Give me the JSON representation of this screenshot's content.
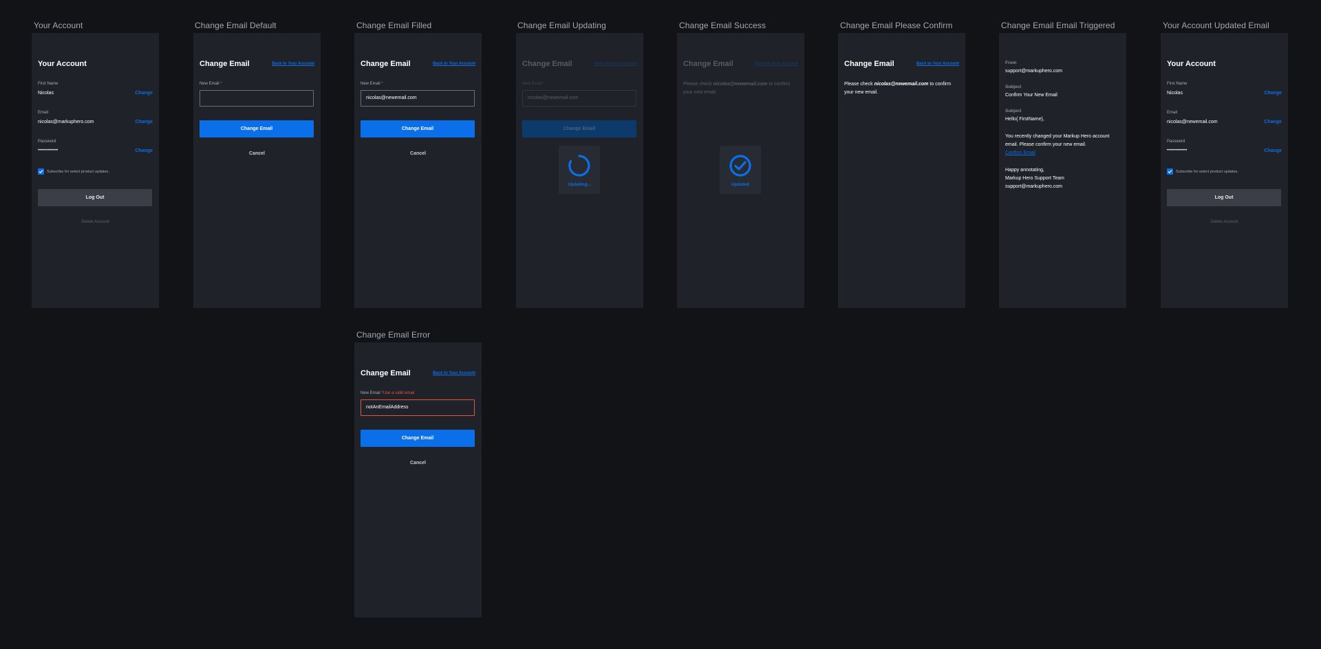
{
  "frames": {
    "account": {
      "label": "Your Account",
      "title": "Your Account",
      "first_name_label": "First Name",
      "first_name_value": "Nicolas",
      "email_label": "Email",
      "email_value": "nicolas@markuphero.com",
      "password_label": "Password",
      "password_value": "••••••••••••••",
      "change_label": "Change",
      "subscribe_label": "Subscribe for select product updates.",
      "subscribe_checked": true,
      "logout_label": "Log Out",
      "delete_label": "Delete Account"
    },
    "change_default": {
      "label": "Change Email Default",
      "title": "Change Email",
      "back_link": "Back to Your Account",
      "new_email_label": "New Email",
      "required_mark": "*",
      "input_value": "",
      "submit_label": "Change Email",
      "cancel_label": "Cancel"
    },
    "change_filled": {
      "label": "Change Email Filled",
      "title": "Change Email",
      "back_link": "Back to Your Account",
      "new_email_label": "New Email",
      "required_mark": "*",
      "input_value": "nicolas@newemail.com",
      "submit_label": "Change Email",
      "cancel_label": "Cancel"
    },
    "change_updating": {
      "label": "Change Email Updating",
      "title": "Change Email",
      "back_link": "Back to Your Account",
      "new_email_label": "New Email",
      "required_mark": "*",
      "input_value": "nicolas@newemail.com",
      "submit_label": "Change Email",
      "status_label": "Updating..."
    },
    "change_success": {
      "label": "Change Email Success",
      "title": "Change Email",
      "back_link": "Back to Your Account",
      "msg_prefix": "Please check ",
      "msg_email": "nicolas@newemail.com",
      "msg_suffix": " to confirm your new email.",
      "status_label": "Updated"
    },
    "change_confirm": {
      "label": "Change Email Please Confirm",
      "title": "Change Email",
      "back_link": "Back to Your Account",
      "msg_prefix": "Please check ",
      "msg_email": "nicolas@newemail.com",
      "msg_suffix": " to confirm your new email."
    },
    "email_triggered": {
      "label": "Change Email Email Triggered",
      "from_label": "From",
      "from_value": "support@markuphero.com",
      "subject_label": "Subject",
      "subject_value": "Confirm Your New Email",
      "body_label": "Subject",
      "greeting": "Hello{ FirstName},",
      "body_text": "You recently changed your Markup Hero account email. Please confirm your new email.",
      "confirm_link": "Confirm Email",
      "signoff_1": "Happy annotating,",
      "signoff_2": "Markup Hero Support Team",
      "signoff_3": "support@markuphero.com"
    },
    "account_updated": {
      "label": "Your Account Updated Email",
      "title": "Your Account",
      "first_name_label": "First Name",
      "first_name_value": "Nicolas",
      "email_label": "Email",
      "email_value": "nicolas@newemail.com",
      "password_label": "Password",
      "password_value": "••••••••••••••",
      "change_label": "Change",
      "subscribe_label": "Subscribe for select product updates.",
      "subscribe_checked": true,
      "logout_label": "Log Out",
      "delete_label": "Delete Account"
    },
    "change_error": {
      "label": "Change Email Error",
      "title": "Change Email",
      "back_link": "Back to Your Account",
      "new_email_label": "New Email",
      "error_text": "*Use a valid email",
      "input_value": "notAnEmailAddress",
      "submit_label": "Change Email",
      "cancel_label": "Cancel"
    }
  },
  "icons": {
    "checkbox": "check-icon",
    "spinner": "spinner-icon",
    "success": "check-circle-icon"
  },
  "colors": {
    "background": "#121316",
    "frame": "#1f2228",
    "accent": "#0a6fe8",
    "error": "#e8553e"
  }
}
